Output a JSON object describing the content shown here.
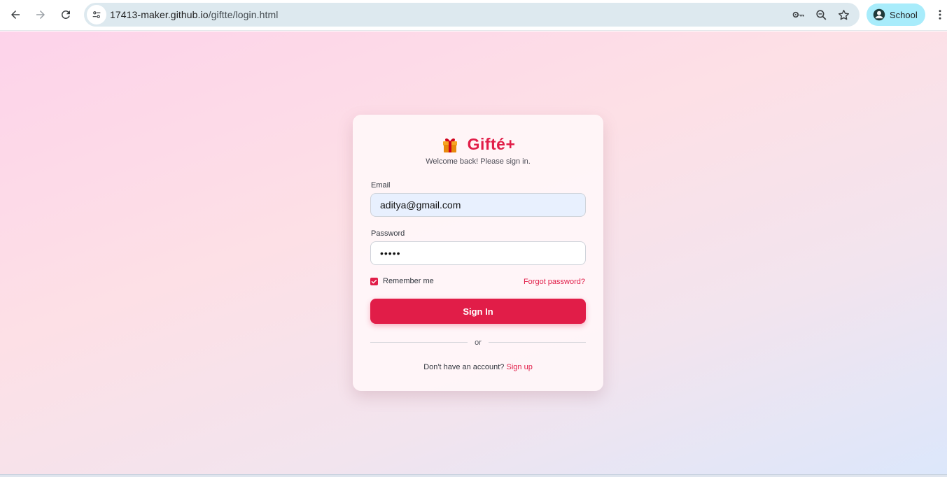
{
  "browser": {
    "url_host": "17413-maker.github.io",
    "url_path": "/giftte/login.html",
    "profile_label": "School",
    "profile_chip_color": "#a8ecfb"
  },
  "icons": {
    "back": "arrow-left-icon",
    "forward": "arrow-right-icon",
    "reload": "reload-icon",
    "site_info": "tune-icon",
    "password_key": "key-icon",
    "zoom": "zoom-icon",
    "bookmark": "star-icon",
    "profile": "user-avatar-icon",
    "menu": "more-vertical-icon",
    "brand": "gift-icon"
  },
  "login": {
    "brand_name": "Gifté+",
    "subtitle": "Welcome back! Please sign in.",
    "email_label": "Email",
    "email_value": "aditya@gmail.com",
    "password_label": "Password",
    "password_value": "•••••",
    "remember_label": "Remember me",
    "remember_checked": true,
    "forgot_label": "Forgot password?",
    "signin_label": "Sign In",
    "divider_text": "or",
    "signup_prompt": "Don't have an account?",
    "signup_link": "Sign up"
  },
  "colors": {
    "accent": "#e11d48",
    "email_field_bg": "#e8f0fe"
  }
}
